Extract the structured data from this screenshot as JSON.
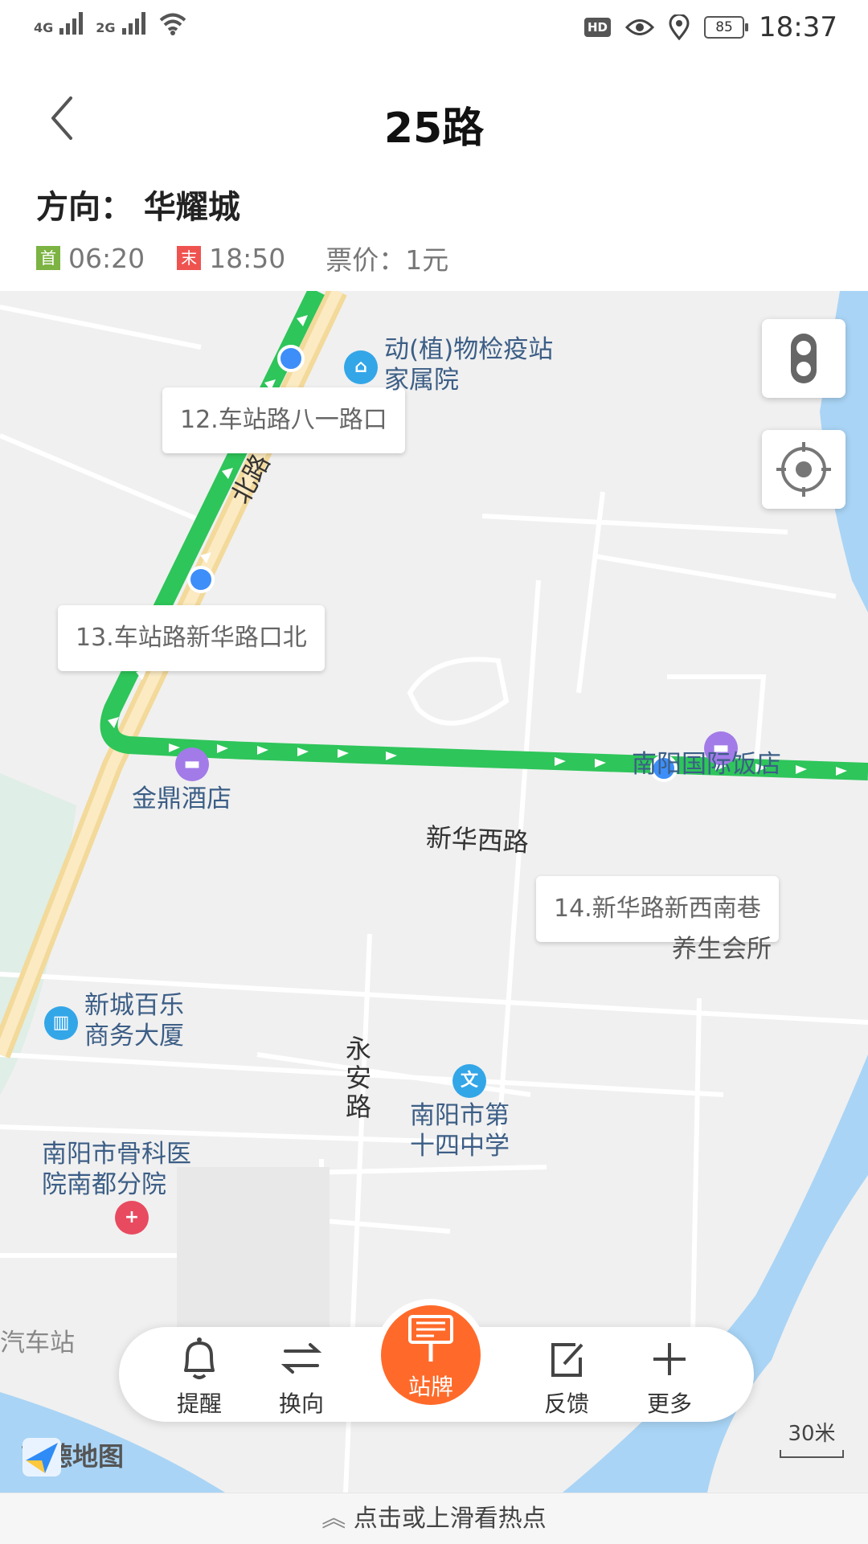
{
  "status_bar": {
    "net1": "4G",
    "net2": "2G",
    "hd": "HD",
    "battery": "85",
    "time": "18:37"
  },
  "header": {
    "title": "25路"
  },
  "route_info": {
    "direction": "方向： 华耀城",
    "first_tag": "首",
    "first_time": "06:20",
    "last_tag": "末",
    "last_time": "18:50",
    "fare": "票价：1元"
  },
  "map": {
    "stops": [
      "12.车站路八一路口",
      "13.车站路新华路口北",
      "14.新华路新西南巷"
    ],
    "pois": [
      "动(植)物检疫站家属院",
      "南阳国际饭店",
      "金鼎酒店",
      "养生会所",
      "新城百乐商务大厦",
      "南阳市第十四中学",
      "南阳市骨科医院南都分院",
      "汽车站"
    ],
    "roads": [
      "北路",
      "新华西路",
      "永安路"
    ],
    "logo": "高德地图",
    "scale": "30米",
    "colors": {
      "route": "#2ec55a",
      "stop_dot": "#3d8ef8",
      "water": "#a9d4f5"
    }
  },
  "toolbar": {
    "remind": "提醒",
    "switch_dir": "换向",
    "stop_sign": "站牌",
    "feedback": "反馈",
    "more": "更多"
  },
  "footer": {
    "hint": "点击或上滑看热点"
  }
}
